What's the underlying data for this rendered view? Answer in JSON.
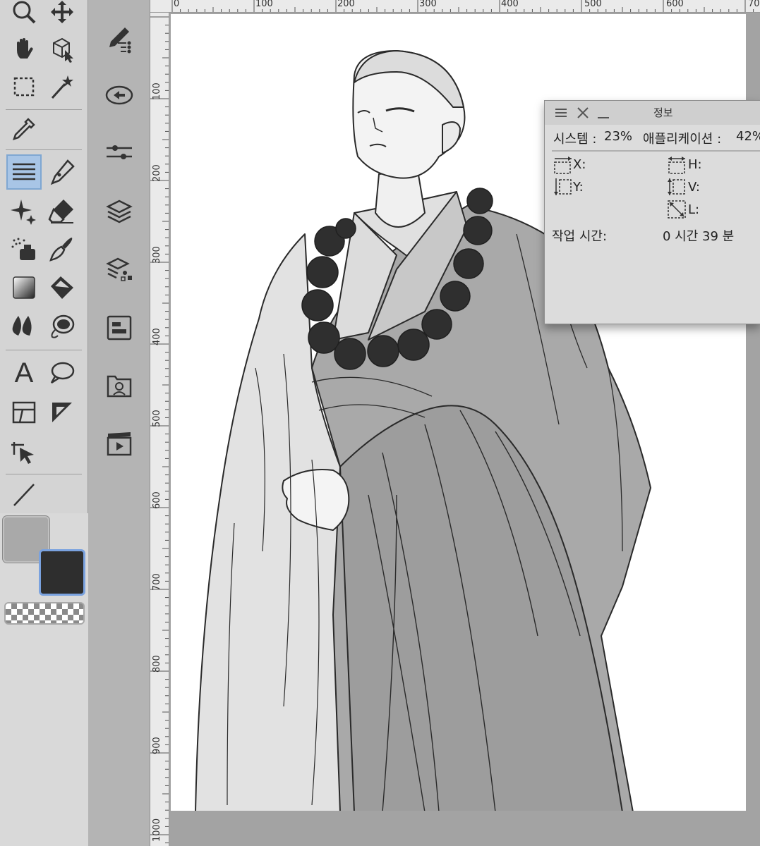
{
  "app": {
    "accent_color": "#a8c5e6",
    "main_color": "#a9a9a9",
    "sub_color": "#2e2e2e"
  },
  "tool_palette": {
    "tools": [
      "zoom-icon",
      "move-icon",
      "hand-icon",
      "object-select-icon",
      "rect-select-icon",
      "auto-select-icon",
      "eyedropper-icon",
      "hatch-pen-icon",
      "pen-icon",
      "decoration-icon",
      "eraser-icon",
      "airbrush-icon",
      "brush-icon",
      "gradient-icon",
      "fill-icon",
      "blend-icon",
      "lasso-fill-icon",
      "text-icon",
      "balloon-icon",
      "frame-border-icon",
      "ruler-icon",
      "operation-icon",
      "line-icon"
    ],
    "selected_tool": "hatch-pen-icon",
    "text_tool_glyph": "A"
  },
  "command_bar": {
    "items": [
      "vector-brush-icon",
      "transfer-icon",
      "adjust-icon",
      "layers-icon",
      "material-icon",
      "navigator-icon",
      "character-icon",
      "animation-icon"
    ]
  },
  "rulers": {
    "horizontal": [
      "0",
      "100",
      "200",
      "300",
      "400",
      "500",
      "600",
      "70"
    ],
    "vertical": [
      "100",
      "200",
      "300",
      "400",
      "500",
      "600",
      "700",
      "800",
      "900",
      "1000"
    ]
  },
  "info_panel": {
    "title": "정보",
    "system_label": "시스템 :",
    "system_value": "23%",
    "app_label": "애플리케이션 :",
    "app_value": "42%",
    "x_label": "X:",
    "y_label": "Y:",
    "h_label": "H:",
    "v_label": "V:",
    "l_label": "L:",
    "work_time_label": "작업 시간:",
    "work_time_value": "0 시간 39 분"
  }
}
